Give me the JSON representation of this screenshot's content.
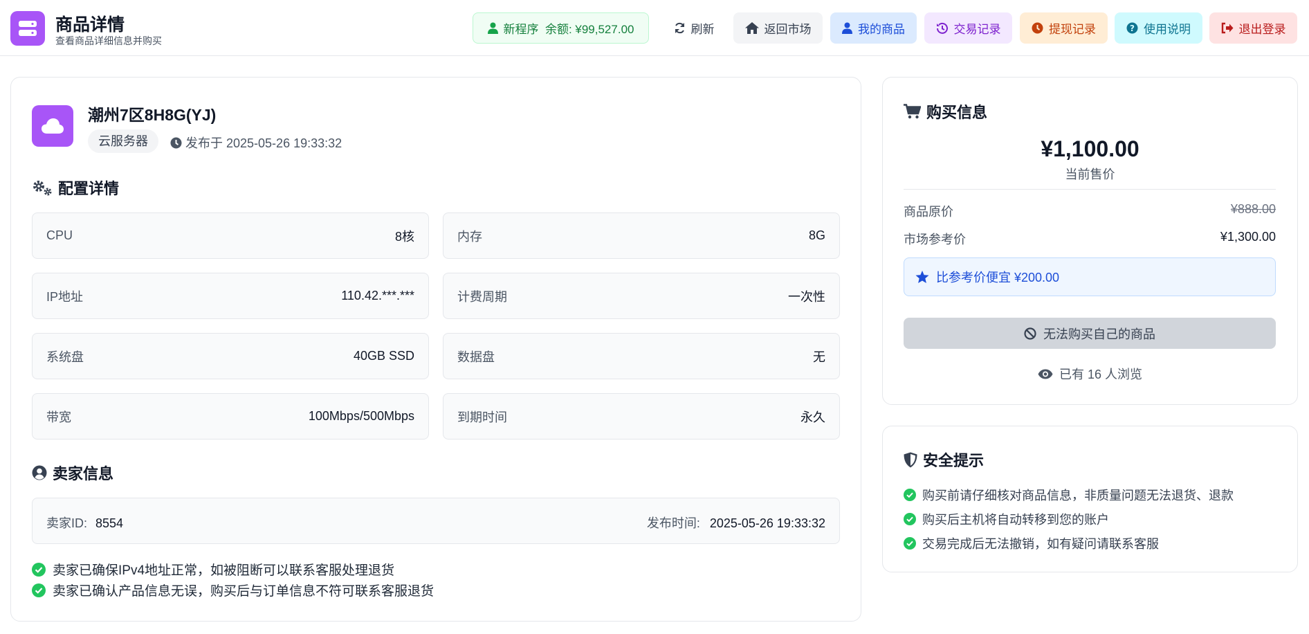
{
  "header": {
    "title": "商品详情",
    "subtitle": "查看商品详细信息并购买",
    "balance": "新程序  余额: ¥99,527.00",
    "nav": {
      "refresh": "刷新",
      "market": "返回市场",
      "my_goods": "我的商品",
      "trades": "交易记录",
      "withdrawals": "提现记录",
      "usage": "使用说明",
      "logout": "退出登录"
    }
  },
  "product": {
    "name": "潮州7区8H8G(YJ)",
    "type": "云服务器",
    "published": "发布于 2025-05-26 19:33:32"
  },
  "config": {
    "title": "配置详情",
    "specs": [
      {
        "key": "CPU",
        "value": "8核"
      },
      {
        "key": "内存",
        "value": "8G"
      },
      {
        "key": "IP地址",
        "value": "110.42.***.***"
      },
      {
        "key": "计费周期",
        "value": "一次性"
      },
      {
        "key": "系统盘",
        "value": "40GB SSD"
      },
      {
        "key": "数据盘",
        "value": "无"
      },
      {
        "key": "带宽",
        "value": "100Mbps/500Mbps"
      },
      {
        "key": "到期时间",
        "value": "永久"
      }
    ]
  },
  "seller": {
    "title": "卖家信息",
    "id_label": "卖家ID:",
    "id": "8554",
    "time_label": "发布时间:",
    "time": "2025-05-26 19:33:32",
    "promises": [
      "卖家已确保IPv4地址正常，如被阻断可以联系客服处理退货",
      "卖家已确认产品信息无误，购买后与订单信息不符可联系客服退货"
    ]
  },
  "purchase": {
    "title": "购买信息",
    "price": "¥1,100.00",
    "price_label": "当前售价",
    "original_label": "商品原价",
    "original": "¥888.00",
    "market_label": "市场参考价",
    "market": "¥1,300.00",
    "saving": "比参考价便宜 ¥200.00",
    "button": "无法购买自己的商品",
    "views": "已有 16 人浏览"
  },
  "safety": {
    "title": "安全提示",
    "tips": [
      "购买前请仔细核对商品信息，非质量问题无法退货、退款",
      "购买后主机将自动转移到您的账户",
      "交易完成后无法撤销，如有疑问请联系客服"
    ]
  },
  "colors": {
    "accent_purple": "#a855f7",
    "success_green": "#22c55e",
    "info_blue": "#1d4ed8"
  }
}
